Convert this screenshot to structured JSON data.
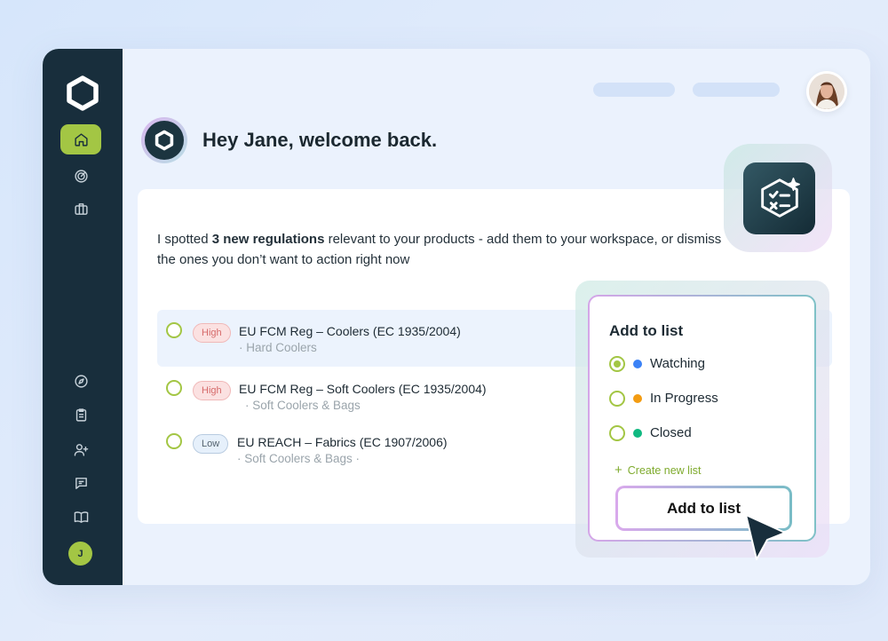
{
  "sidebar": {
    "items": [
      {
        "name": "home",
        "icon": "home-icon",
        "active": true
      },
      {
        "name": "radar",
        "icon": "radar-icon",
        "active": false
      },
      {
        "name": "briefcase",
        "icon": "briefcase-icon",
        "active": false
      },
      {
        "name": "explore",
        "icon": "compass-icon",
        "active": false
      },
      {
        "name": "clipboard",
        "icon": "clipboard-icon",
        "active": false
      },
      {
        "name": "add-user",
        "icon": "user-plus-icon",
        "active": false
      },
      {
        "name": "messages",
        "icon": "chat-icon",
        "active": false
      },
      {
        "name": "docs",
        "icon": "book-icon",
        "active": false
      }
    ],
    "user_initial": "J"
  },
  "header": {
    "welcome": "Hey Jane, welcome back."
  },
  "card": {
    "intro_prefix": "I spotted ",
    "intro_bold": "3 new regulations",
    "intro_suffix": " relevant to your products - add them to your workspace, or dismiss the ones you don’t want to action right now",
    "regulations": [
      {
        "priority": "High",
        "title": "EU FCM Reg – Coolers (EC 1935/2004)",
        "sub": "· Hard Coolers"
      },
      {
        "priority": "High",
        "title": "EU FCM Reg – Soft Coolers (EC 1935/2004)",
        "sub": "· Soft Coolers & Bags"
      },
      {
        "priority": "Low",
        "title": "EU REACH – Fabrics (EC 1907/2006)",
        "sub": "· Soft Coolers & Bags ·"
      }
    ]
  },
  "popup": {
    "title": "Add to list",
    "options": [
      {
        "label": "Watching",
        "color": "#3b82f6",
        "checked": true
      },
      {
        "label": "In Progress",
        "color": "#f39c12",
        "checked": false
      },
      {
        "label": "Closed",
        "color": "#10b981",
        "checked": false
      }
    ],
    "create_label": "Create new list",
    "button_label": "Add to list"
  },
  "colors": {
    "sidebar": "#182e3c",
    "accent": "#a3c644",
    "high_tag": "#d66a6a"
  }
}
